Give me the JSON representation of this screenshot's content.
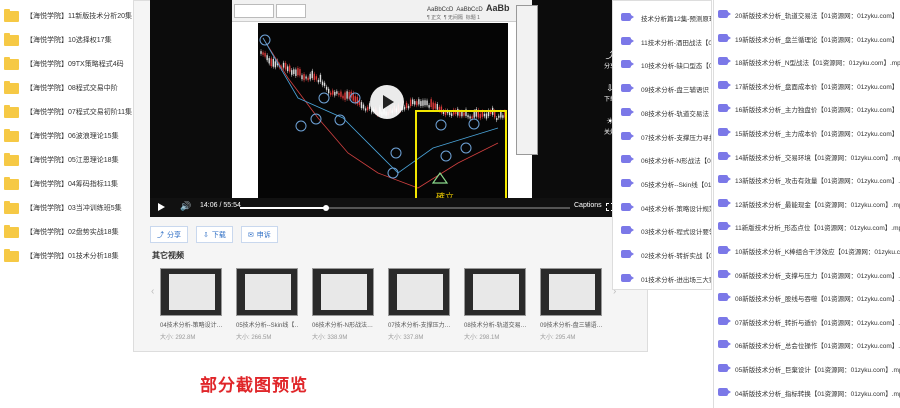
{
  "left_folders": [
    "【海悦学院】11新版技术分析20集",
    "【海悦学院】10选择权17集",
    "【海悦学院】09TX策略程式4码",
    "【海悦学院】08程式交易中阶",
    "【海悦学院】07程式交易初阶11集",
    "【海悦学院】06波浪理论15集",
    "【海悦学院】05江恩理论18集",
    "【海悦学院】04筹码指标11集",
    "【海悦学院】03当冲训练班5集",
    "【海悦学院】02盘势实战18集",
    "【海悦学院】01技术分析18集"
  ],
  "player": {
    "time_current": "14:06",
    "time_total": "55:54",
    "progress": 0.26,
    "captions_label": "Captions",
    "chart_annotation": "確立",
    "side_tools": [
      "分享",
      "下载",
      "关灯"
    ]
  },
  "doc_toolbar": {
    "styles": [
      "AaBbCcD",
      "AaBbCcD",
      "AaBb"
    ],
    "style_names": [
      "¶ 正文",
      "¶ 无间隔",
      "标题 1"
    ]
  },
  "actions": [
    {
      "icon": "share-icon",
      "label": "分享"
    },
    {
      "icon": "download-icon",
      "label": "下载"
    },
    {
      "icon": "comment-icon",
      "label": "申诉"
    }
  ],
  "other_videos_title": "其它视频",
  "thumbs": [
    {
      "title": "04技术分析-策略设计…",
      "size": "大小: 292.8M"
    },
    {
      "title": "05技术分析--Skin线【…",
      "size": "大小: 266.5M"
    },
    {
      "title": "06技术分析-N形战法…",
      "size": "大小: 338.9M"
    },
    {
      "title": "07技术分析-支撑压力…",
      "size": "大小: 337.8M"
    },
    {
      "title": "08技术分析-轨道交易…",
      "size": "大小: 298.1M"
    },
    {
      "title": "09技术分析-盘三辅语…",
      "size": "大小: 295.4M"
    }
  ],
  "preview_label": "部分截图预览",
  "mid_list": [
    "技术分析篇12集-预测原理",
    "11技术分析-酒田战法【0",
    "10技术分析-缺口型态【0",
    "09技术分析-盘三辅语识【",
    "08技术分析-轨道交易法【",
    "07技术分析-支撑压力寻找",
    "06技术分析-N形战法【01",
    "05技术分析--Skin线【01",
    "04技术分析-策略设计规范",
    "03技术分析-程式设计要领",
    "02技术分析-转折实战【0",
    "01技术分析-进出场三大要"
  ],
  "right_list": [
    "20新版技术分析_轨道交易法【01资源网：01zyku.com】",
    "19新版技术分析_盘兰循理论【01资源网：01zyku.com】",
    "18新版技术分析_N型战法【01资源网：01zyku.com】.mp4",
    "17新版技术分析_盘面成本价【01资源网：01zyku.com】",
    "16新版技术分析_主力独盘价【01资源网：01zyku.com】",
    "15新版技术分析_主力成本价【01资源网：01zyku.com】",
    "14新版技术分析_交易环境【01资源网：01zyku.com】.mp4",
    "13新版技术分析_攻击有效量【01资源网：01zyku.com】.mp4",
    "12新版技术分析_最能现金【01资源网：01zyku.com】.mp4",
    "11新版技术分析_形态点位【01资源网：01zyku.com】.mp4",
    "10新版技术分析_K棒组合干涉效应【01资源网：01zyku.com】",
    "09新版技术分析_支撑与压力【01资源网：01zyku.com】.mp4",
    "08新版技术分析_股线与吞噬【01资源网：01zyku.com】.mp4",
    "07新版技术分析_转折与遁价【01资源网：01zyku.com】.mp4",
    "06新版技术分析_总会位操作【01资源网：01zyku.com】.mp4",
    "05新版技术分析_巨棄设计【01资源网：01zyku.com】.mp4",
    "04新版技术分析_指标转换【01资源网：01zyku.com】.mp4"
  ]
}
